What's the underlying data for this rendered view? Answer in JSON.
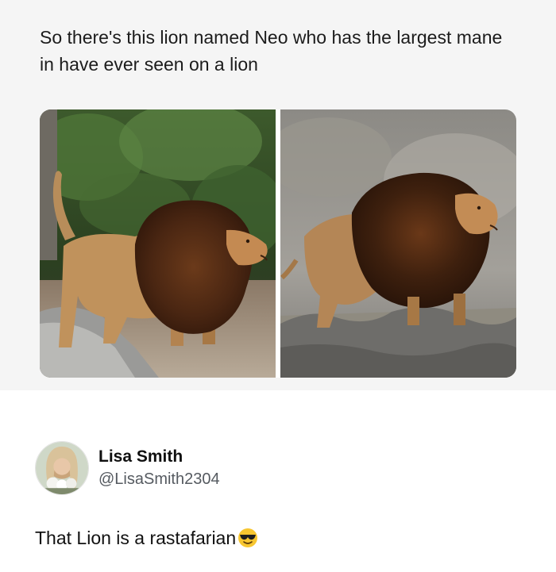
{
  "post": {
    "text": "So there's this lion named Neo who has the largest mane in have ever seen on a lion",
    "images": [
      {
        "name": "lion-walking-left-photo"
      },
      {
        "name": "lion-standing-right-photo"
      }
    ]
  },
  "reply": {
    "display_name": "Lisa Smith",
    "handle": "@LisaSmith2304",
    "text": "That Lion is a rastafarian",
    "emoji": "sunglasses-face"
  },
  "colors": {
    "post_background": "#f5f5f5",
    "reply_background": "#ffffff",
    "handle_gray": "#555a60"
  }
}
